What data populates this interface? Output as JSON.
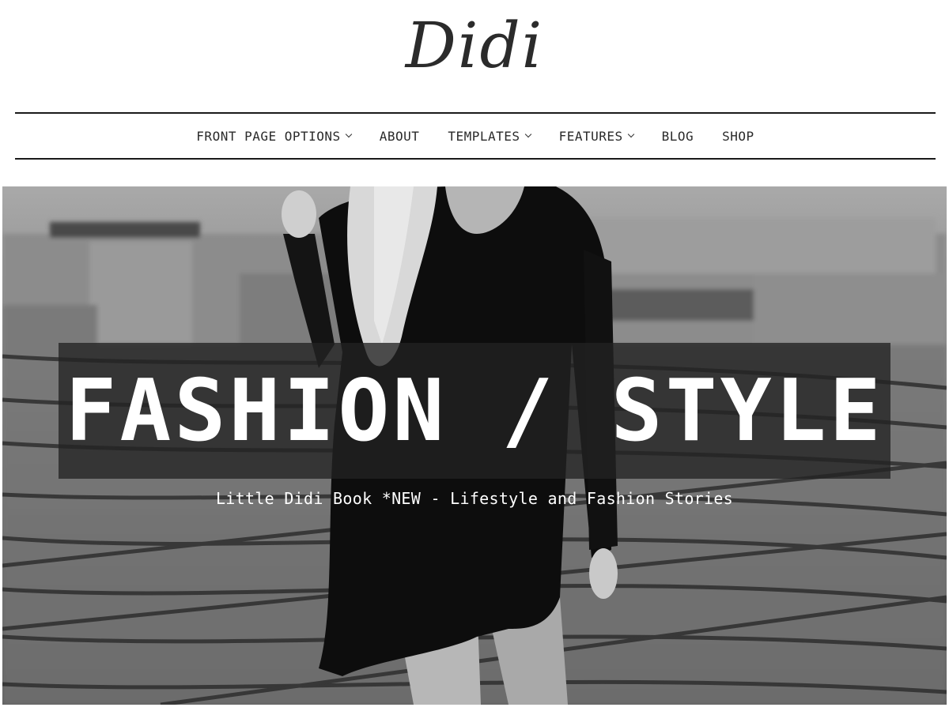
{
  "header": {
    "logo_text": "Didi"
  },
  "nav": {
    "items": [
      {
        "label": "FRONT PAGE OPTIONS",
        "has_dropdown": true
      },
      {
        "label": "ABOUT",
        "has_dropdown": false
      },
      {
        "label": "TEMPLATES",
        "has_dropdown": true
      },
      {
        "label": "FEATURES",
        "has_dropdown": true
      },
      {
        "label": "BLOG",
        "has_dropdown": false
      },
      {
        "label": "SHOP",
        "has_dropdown": false
      }
    ],
    "dropdown_icon": "chevron-down-icon"
  },
  "hero": {
    "title": "FASHION / STYLE",
    "subtitle": "Little Didi Book *NEW - Lifestyle and Fashion Stories",
    "image_description_icon": "hero-photo"
  },
  "colors": {
    "text": "#2a2a2a",
    "hero_overlay": "#232323",
    "hero_text": "#ffffff",
    "rule": "#1a1a1a"
  }
}
